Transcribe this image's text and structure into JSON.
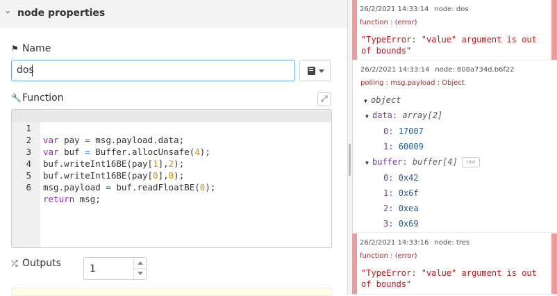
{
  "left": {
    "section_title": "node properties",
    "name_label": "Name",
    "name_value": "dos",
    "function_label": "Function",
    "outputs_label": "Outputs",
    "outputs_value": "1",
    "code": {
      "lines": [
        {
          "n": "1"
        },
        {
          "n": "2"
        },
        {
          "n": "3"
        },
        {
          "n": "4"
        },
        {
          "n": "5"
        },
        {
          "n": "6"
        }
      ]
    }
  },
  "debug": {
    "messages": [
      {
        "timestamp": "26/2/2021 14:33:14",
        "node": "node: dos",
        "topic": "function : (error)",
        "error_line1": "\"TypeError: \"value\" argument is out",
        "error_line2": "of bounds\""
      },
      {
        "timestamp": "26/2/2021 14:33:14",
        "node": "node: 808a734d.b6f22",
        "topic": "polling : msg.payload : Object",
        "root_type": "object",
        "data_key": "data:",
        "data_type": "array[2]",
        "data_items": [
          {
            "idx": "0:",
            "val": "17007"
          },
          {
            "idx": "1:",
            "val": "60009"
          }
        ],
        "buffer_key": "buffer:",
        "buffer_type": "buffer[4]",
        "raw_label": "raw",
        "buffer_items": [
          {
            "idx": "0:",
            "val": "0x42"
          },
          {
            "idx": "1:",
            "val": "0x6f"
          },
          {
            "idx": "2:",
            "val": "0xea"
          },
          {
            "idx": "3:",
            "val": "0x69"
          }
        ]
      },
      {
        "timestamp": "26/2/2021 14:33:16",
        "node": "node: tres",
        "topic": "function : (error)",
        "error_line1": "\"TypeError: \"value\" argument is out",
        "error_line2": "of bounds\""
      }
    ]
  },
  "colors": {
    "error_bar": "#f2999b",
    "focus_border": "#67a9d9"
  },
  "icons": [
    "chevron-down-icon",
    "tag-icon",
    "book-icon",
    "wrench-icon",
    "expand-icon",
    "shuffle-icon"
  ]
}
